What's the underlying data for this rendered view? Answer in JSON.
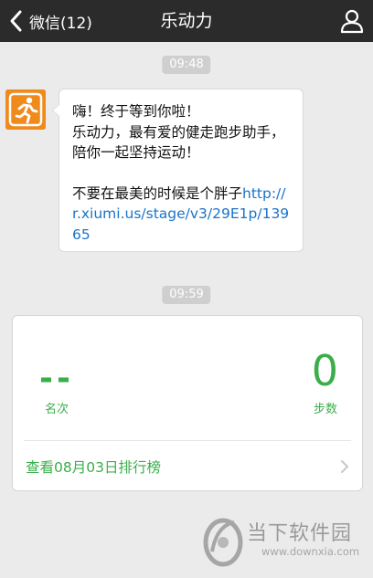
{
  "topbar": {
    "back_label": "微信(12)",
    "title": "乐动力",
    "bg_color": "#2b2b2b"
  },
  "messages": [
    {
      "time": "09:48"
    },
    {
      "time": "09:59"
    }
  ],
  "bubble": {
    "line1": "嗨！终于等到你啦！",
    "line2": "乐动力，最有爱的健走跑步助手，陪你一起坚持运动！",
    "promo_text": "不要在最美的时候是个胖子",
    "link": "http://r.xiumi.us/stage/v3/29E1p/13965",
    "link_color": "#1a73c9"
  },
  "card": {
    "rank_value": "--",
    "rank_label": "名次",
    "steps_value": "0",
    "steps_label": "步数",
    "ranking_link": "查看08月03日排行榜",
    "accent_color": "#3aae49"
  },
  "watermark": {
    "brand": "当下软件园",
    "url": "www.downxia.com"
  },
  "icons": {
    "back": "chevron-left-icon",
    "profile": "person-icon",
    "avatar": "runner-icon",
    "ranking": "chevron-right-icon"
  }
}
